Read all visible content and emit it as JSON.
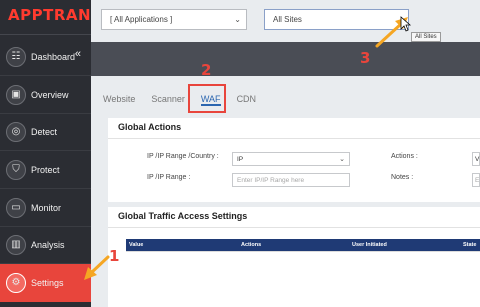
{
  "brand": {
    "logo_text": "APPTRANA"
  },
  "sidebar": {
    "items": [
      {
        "label": "Dashboard",
        "icon": "dashboard-icon",
        "glyph": "☷",
        "active": false
      },
      {
        "label": "Overview",
        "icon": "overview-icon",
        "glyph": "▣",
        "active": false
      },
      {
        "label": "Detect",
        "icon": "detect-icon",
        "glyph": "◎",
        "active": false
      },
      {
        "label": "Protect",
        "icon": "shield-icon",
        "glyph": "⛉",
        "active": false
      },
      {
        "label": "Monitor",
        "icon": "monitor-icon",
        "glyph": "▭",
        "active": false
      },
      {
        "label": "Analysis",
        "icon": "analysis-icon",
        "glyph": "▥",
        "active": false
      },
      {
        "label": "Settings",
        "icon": "gear-icon",
        "glyph": "⚙",
        "active": true
      }
    ],
    "collapse_glyph": "«"
  },
  "topbar": {
    "applications_select": "[ All Applications ]",
    "sites_select": "All Sites",
    "sites_tooltip": "All Sites"
  },
  "tabs": [
    {
      "label": "Website",
      "active": false
    },
    {
      "label": "Scanner",
      "active": false
    },
    {
      "label": "WAF",
      "active": true
    },
    {
      "label": "CDN",
      "active": false
    }
  ],
  "global_actions": {
    "title": "Global Actions",
    "ip_range_country_label": "IP /IP Range /Country :",
    "ip_range_country_value": "IP",
    "ip_range_label": "IP /IP Range :",
    "ip_range_placeholder": "Enter IP/IP Range here",
    "actions_label": "Actions :",
    "actions_value": "V",
    "notes_label": "Notes :",
    "notes_value": "E"
  },
  "traffic_settings": {
    "title": "Global Traffic Access Settings",
    "columns": [
      "Value",
      "Actions",
      "User Initiated",
      "State"
    ]
  },
  "annotations": {
    "step_1": "1",
    "step_2": "2",
    "step_3": "3",
    "arrow_color": "#f5a623",
    "highlight_color": "#e8453c"
  }
}
